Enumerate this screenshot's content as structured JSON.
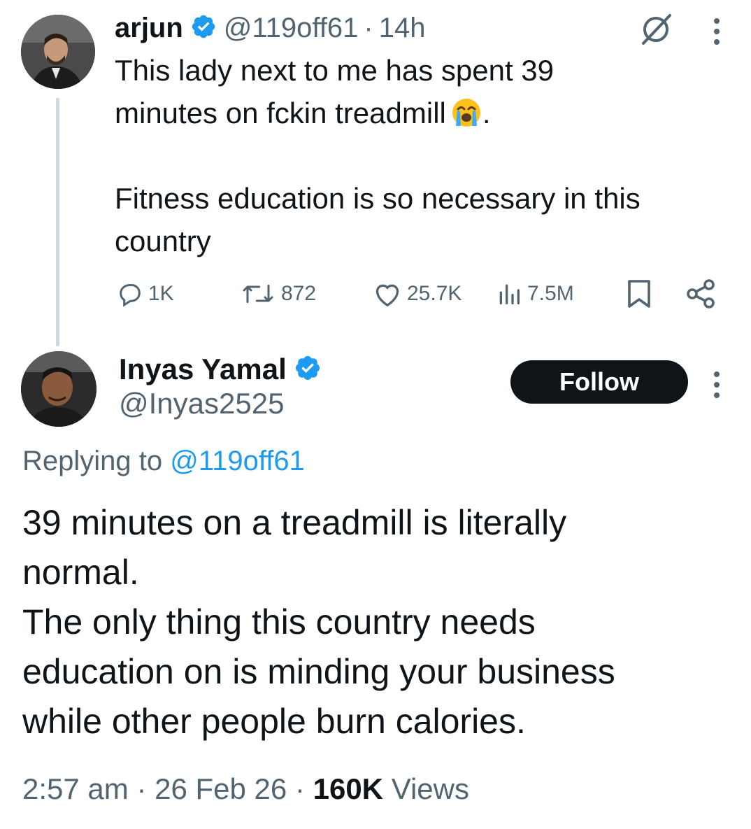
{
  "tweet1": {
    "name": "arjun",
    "handle": "@119off61",
    "separator": "·",
    "time": "14h",
    "text_lines": [
      "This lady next to me has spent 39",
      "minutes on fckin treadmill",
      "",
      "Fitness education is so necessary in this",
      "country"
    ],
    "line2_suffix": ".",
    "emoji_icon": "loudly-crying-face-emoji",
    "actions": {
      "replies": "1K",
      "retweets": "872",
      "likes": "25.7K",
      "views": "7.5M"
    }
  },
  "tweet2": {
    "name": "Inyas Yamal",
    "handle": "@Inyas2525",
    "follow_label": "Follow",
    "replying_prefix": "Replying to",
    "replying_mention": "@119off61",
    "text_lines": [
      "39 minutes on a treadmill is literally",
      "normal.",
      "The only thing this country needs",
      "education on is minding your business",
      "while other people burn calories."
    ],
    "time": "2:57 am",
    "date": "26 Feb 26",
    "separator": "·",
    "views_count": "160K",
    "views_label": "Views"
  },
  "colors": {
    "text": "#0f1419",
    "secondary": "#536471",
    "link": "#1d9bf0",
    "verified": "#1d9bf0",
    "thread_line": "#cfd9de"
  }
}
